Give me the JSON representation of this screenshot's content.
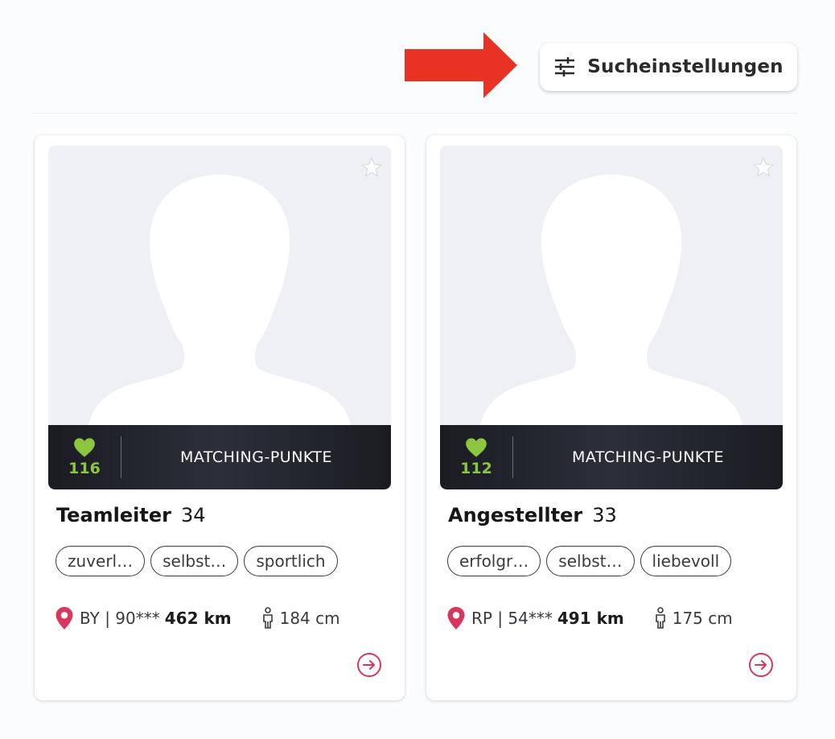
{
  "header": {
    "search_settings_label": "Sucheinstellungen",
    "icons": {
      "settings": "sliders-icon",
      "arrow": "red-arrow-right"
    }
  },
  "colors": {
    "accent_red": "#e83223",
    "match_green": "#8cc63f",
    "brand_pink": "#d9365e",
    "dark_bar": "#1f2029"
  },
  "profiles": [
    {
      "match_points": "116",
      "match_label": "MATCHING-PUNKTE",
      "title": "Teamleiter",
      "age": "34",
      "tags": [
        "zuverl…",
        "selbst…",
        "sportlich"
      ],
      "location": "BY | 90***",
      "distance": "462 km",
      "height": "184 cm"
    },
    {
      "match_points": "112",
      "match_label": "MATCHING-PUNKTE",
      "title": "Angestellter",
      "age": "33",
      "tags": [
        "erfolgr…",
        "selbst…",
        "liebevoll"
      ],
      "location": "RP | 54***",
      "distance": "491 km",
      "height": "175 cm"
    }
  ]
}
